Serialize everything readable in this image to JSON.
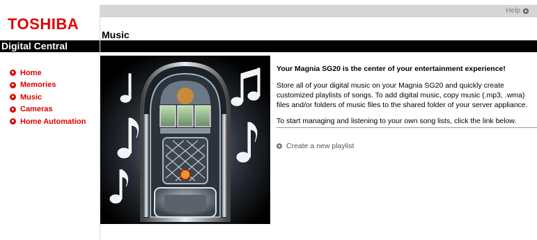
{
  "brand": {
    "logo_text": "TOSHIBA",
    "product": "Digital Central",
    "logo_color": "#e00000"
  },
  "header": {
    "help_label": "Help",
    "page_title": "Music"
  },
  "sidebar": {
    "items": [
      {
        "label": "Home",
        "icon": "arrow-circle-icon"
      },
      {
        "label": "Memories",
        "icon": "arrow-circle-icon"
      },
      {
        "label": "Music",
        "icon": "arrow-circle-icon"
      },
      {
        "label": "Cameras",
        "icon": "arrow-circle-icon"
      },
      {
        "label": "Home Automation",
        "icon": "arrow-circle-icon"
      }
    ]
  },
  "hero": {
    "icon": "jukebox-music-notes-image"
  },
  "content": {
    "heading": "Your Magnia SG20 is the center of your entertainment experience!",
    "paragraph1": "Store all of your digital music on your Magnia SG20 and quickly create customized playlists of songs. To add digital music, copy music (.mp3, .wma) files and/or folders of music files to the shared folder of your server appliance.",
    "paragraph2": "To start managing and listening to your own song lists, click the link below.",
    "action_label": "Create a new playlist"
  }
}
